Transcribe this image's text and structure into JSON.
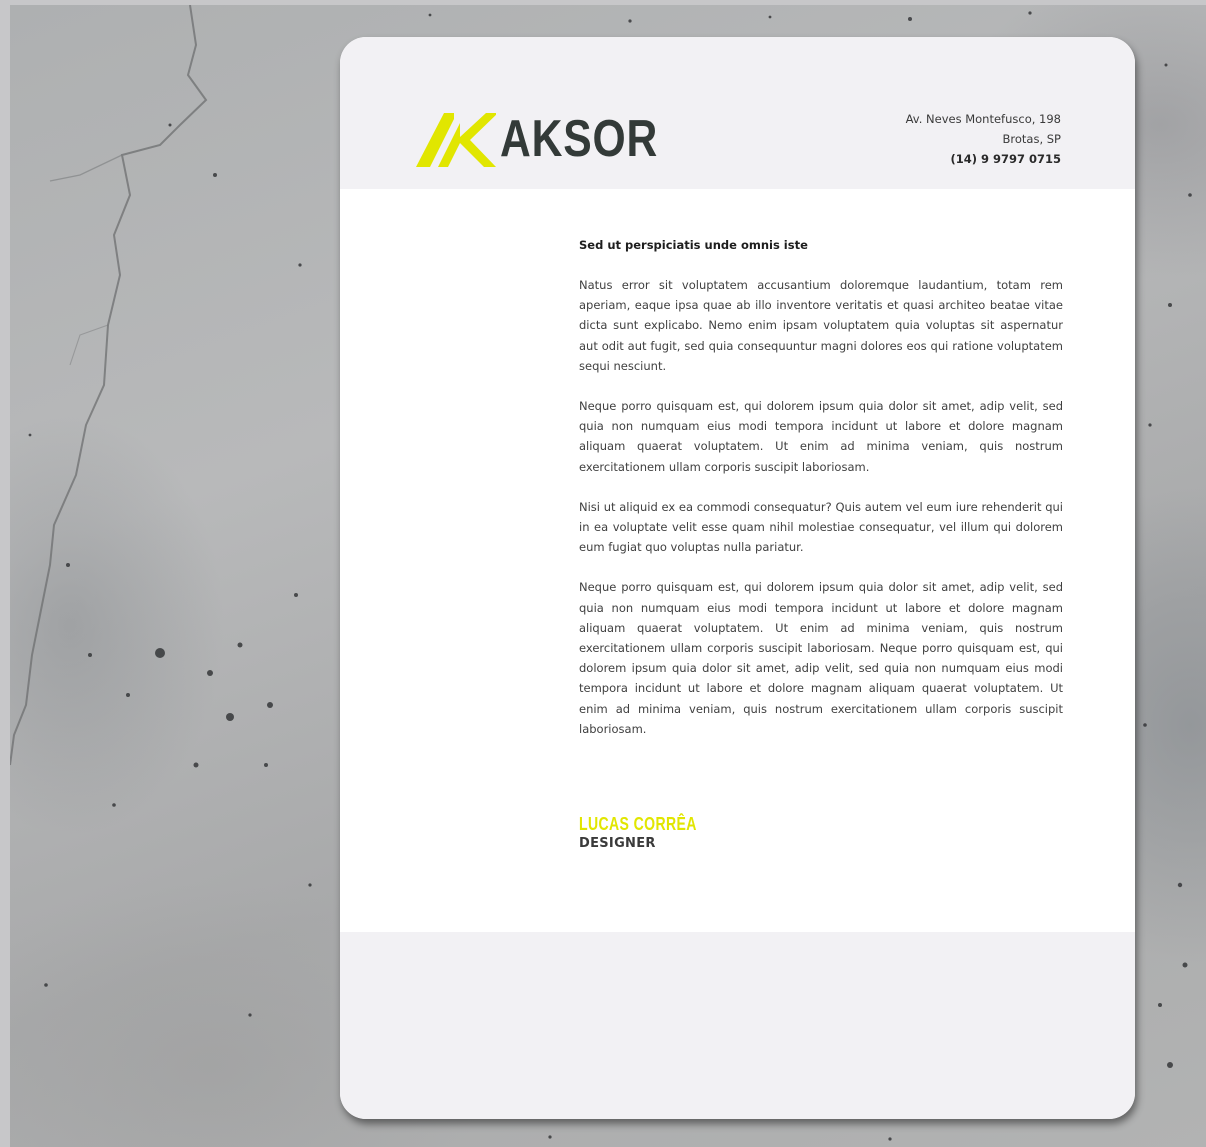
{
  "colors": {
    "accent": "#e1e600",
    "logo_dark": "#333a38",
    "header_band": "#f2f1f4",
    "paper": "#ffffff"
  },
  "logo": {
    "icon": "ak-monogram-icon",
    "wordmark": "AKSOR"
  },
  "address": {
    "street": "Av. Neves Montefusco, 198",
    "city": "Brotas, SP",
    "phone": "(14) 9 9797 0715"
  },
  "letter": {
    "heading": "Sed ut perspiciatis unde omnis iste",
    "paragraphs": [
      "Natus error sit voluptatem accusantium doloremque laudantium, totam rem aperiam, eaque ipsa quae ab illo inventore veritatis et quasi architeo beatae vitae dicta sunt explicabo. Nemo enim ipsam voluptatem quia voluptas sit aspernatur aut odit aut fugit, sed quia consequuntur magni dolores eos qui ratione voluptatem sequi nesciunt.",
      "Neque porro quisquam est, qui dolorem ipsum quia dolor sit amet, adip velit, sed quia non numquam eius modi tempora incidunt ut labore et dolore magnam aliquam quaerat voluptatem. Ut enim ad minima veniam, quis nostrum exercitationem ullam corporis suscipit laboriosam.",
      "Nisi ut aliquid ex ea commodi consequatur? Quis autem vel eum iure rehenderit qui in ea voluptate velit esse quam nihil molestiae consequatur, vel illum qui dolorem eum fugiat quo voluptas nulla pariatur.",
      "Neque porro quisquam est, qui dolorem ipsum quia dolor sit amet, adip velit, sed quia non numquam eius modi tempora incidunt ut labore et dolore magnam aliquam quaerat voluptatem. Ut enim ad minima veniam, quis nostrum exercitationem ullam corporis suscipit laboriosam. Neque porro quisquam est, qui dolorem ipsum quia dolor sit amet, adip velit, sed quia non numquam eius modi tempora incidunt ut labore et dolore magnam aliquam quaerat voluptatem. Ut enim ad minima veniam, quis nostrum exercitationem ullam corporis suscipit laboriosam."
    ]
  },
  "signature": {
    "name": "LUCAS CORRÊA",
    "title": "DESIGNER"
  }
}
